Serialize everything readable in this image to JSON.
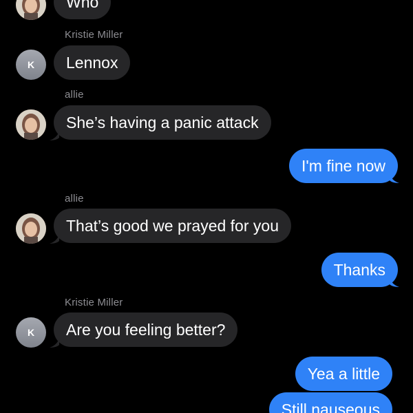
{
  "conversation": {
    "messages": [
      {
        "direction": "in",
        "sender": "",
        "avatar": "allie-photo-avatar",
        "text": "Who"
      },
      {
        "direction": "in",
        "sender": "Kristie Miller",
        "avatar_initial": "K",
        "text": "Lennox"
      },
      {
        "direction": "in",
        "sender": "allie",
        "avatar": "allie-photo-avatar",
        "text": "She’s having a panic attack"
      },
      {
        "direction": "out",
        "text": "I'm fine now"
      },
      {
        "direction": "in",
        "sender": "allie",
        "avatar": "allie-photo-avatar",
        "text": "That’s good we prayed for you"
      },
      {
        "direction": "out",
        "text": "Thanks"
      },
      {
        "direction": "in",
        "sender": "Kristie Miller",
        "avatar_initial": "K",
        "text": "Are you feeling better?"
      },
      {
        "direction": "out",
        "text": "Yea a little"
      },
      {
        "direction": "out",
        "text": "Still nauseous"
      }
    ]
  },
  "colors": {
    "background": "#000000",
    "incoming_bubble": "#262628",
    "outgoing_bubble": "#2f82f7",
    "sender_label": "#8e8e93",
    "text": "#ffffff"
  }
}
